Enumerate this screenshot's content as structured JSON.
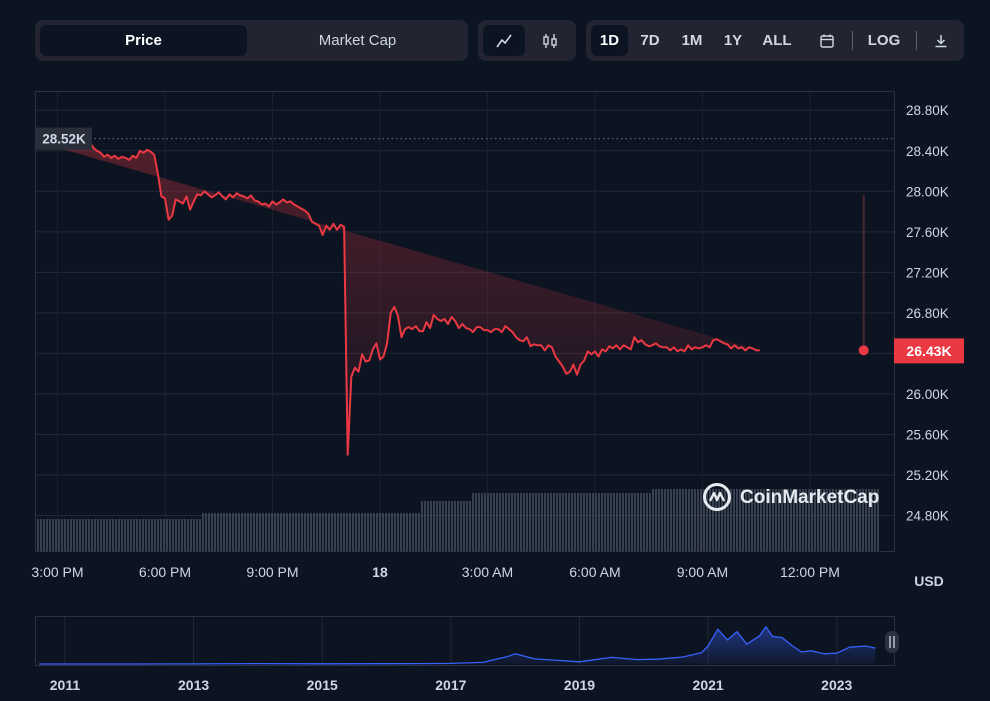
{
  "toolbar": {
    "type_options": [
      {
        "label": "Price",
        "active": true
      },
      {
        "label": "Market Cap",
        "active": false
      }
    ],
    "view_options": [
      {
        "icon": "line-chart-icon",
        "active": true
      },
      {
        "icon": "candlestick-icon",
        "active": false
      }
    ],
    "range_options": [
      {
        "label": "1D",
        "active": true
      },
      {
        "label": "7D",
        "active": false
      },
      {
        "label": "1M",
        "active": false
      },
      {
        "label": "1Y",
        "active": false
      },
      {
        "label": "ALL",
        "active": false
      }
    ],
    "calendar_icon": "calendar-icon",
    "log_label": "LOG",
    "download_icon": "download-icon"
  },
  "watermark": "CoinMarketCap",
  "currency_label": "USD",
  "chart_data": [
    {
      "type": "area",
      "y_ticks": [
        24800,
        25200,
        25600,
        26000,
        26400,
        26800,
        27200,
        27600,
        28000,
        28400,
        28800
      ],
      "y_tick_labels": [
        "24.80K",
        "25.20K",
        "25.60K",
        "26.00K",
        "26.40K",
        "26.80K",
        "27.20K",
        "27.60K",
        "28.00K",
        "28.40K",
        "28.80K"
      ],
      "ylim": [
        24450,
        28980
      ],
      "x_ticks": [
        {
          "label": "3:00 PM",
          "x": 1.5
        },
        {
          "label": "6:00 PM",
          "x": 4.5
        },
        {
          "label": "9:00 PM",
          "x": 7.5
        },
        {
          "label": "18",
          "x": 10.5
        },
        {
          "label": "3:00 AM",
          "x": 13.5
        },
        {
          "label": "6:00 AM",
          "x": 16.5
        },
        {
          "label": "9:00 AM",
          "x": 19.5
        },
        {
          "label": "12:00 PM",
          "x": 22.5
        }
      ],
      "xlim": [
        0.9,
        24.4
      ],
      "high_label": "28.52K",
      "high_value": 28520,
      "last_label": "26.43K",
      "last_value": 26430,
      "line_color": "#ea3943",
      "x": [
        1.6,
        1.7,
        1.8,
        1.9,
        2.0,
        2.1,
        2.2,
        2.3,
        2.4,
        2.5,
        2.6,
        2.7,
        2.8,
        2.9,
        3.0,
        3.1,
        3.2,
        3.3,
        3.4,
        3.5,
        3.6,
        3.7,
        3.8,
        3.9,
        4.0,
        4.1,
        4.2,
        4.3,
        4.4,
        4.5,
        4.6,
        4.7,
        4.8,
        4.9,
        5.0,
        5.1,
        5.2,
        5.3,
        5.4,
        5.5,
        5.6,
        5.7,
        5.8,
        5.9,
        6.0,
        6.1,
        6.2,
        6.3,
        6.4,
        6.5,
        6.6,
        6.7,
        6.8,
        6.9,
        7.0,
        7.1,
        7.2,
        7.3,
        7.4,
        7.5,
        7.6,
        7.7,
        7.8,
        7.9,
        8.0,
        8.1,
        8.2,
        8.3,
        8.4,
        8.5,
        8.6,
        8.7,
        8.8,
        8.9,
        9.0,
        9.1,
        9.2,
        9.3,
        9.4,
        9.5,
        9.6,
        9.7,
        9.8,
        9.9,
        10.0,
        10.1,
        10.2,
        10.3,
        10.4,
        10.5,
        10.6,
        10.7,
        10.8,
        10.9,
        11.0,
        11.1,
        11.2,
        11.3,
        11.4,
        11.5,
        11.6,
        11.7,
        11.8,
        11.9,
        12.0,
        12.1,
        12.2,
        12.3,
        12.4,
        12.5,
        12.6,
        12.7,
        12.8,
        12.9,
        13.0,
        13.1,
        13.2,
        13.3,
        13.4,
        13.5,
        13.6,
        13.7,
        13.8,
        13.9,
        14.0,
        14.1,
        14.2,
        14.3,
        14.4,
        14.5,
        14.6,
        14.7,
        14.8,
        14.9,
        15.0,
        15.1,
        15.2,
        15.3,
        15.4,
        15.5,
        15.6,
        15.7,
        15.8,
        15.9,
        16.0,
        16.1,
        16.2,
        16.3,
        16.4,
        16.5,
        16.6,
        16.7,
        16.8,
        16.9,
        17.0,
        17.1,
        17.2,
        17.3,
        17.4,
        17.5,
        17.6,
        17.7,
        17.8,
        17.9,
        18.0,
        18.1,
        18.2,
        18.3,
        18.4,
        18.5,
        18.6,
        18.7,
        18.8,
        18.9,
        19.0,
        19.1,
        19.2,
        19.3,
        19.4,
        19.5,
        19.6,
        19.7,
        19.8,
        19.9,
        20.0,
        20.1,
        20.2,
        20.3,
        20.4,
        20.5,
        20.6,
        20.7,
        20.8,
        20.9,
        21.0,
        21.1,
        21.2,
        21.3,
        21.4,
        21.5,
        21.6,
        21.7,
        21.8,
        21.9,
        22.0,
        22.1,
        22.2,
        22.3,
        22.4,
        22.5,
        22.6,
        22.7,
        22.8,
        22.9,
        23.0,
        23.1,
        23.2,
        23.3,
        23.4,
        23.5,
        23.6,
        23.7,
        23.8,
        23.9,
        24.0
      ],
      "y": [
        28420,
        28500,
        28480,
        28510,
        28460,
        28480,
        28430,
        28450,
        28490,
        28430,
        28400,
        28380,
        28340,
        28360,
        28330,
        28350,
        28320,
        28340,
        28330,
        28310,
        28350,
        28330,
        28400,
        28380,
        28410,
        28390,
        28360,
        28180,
        27950,
        27930,
        27720,
        27760,
        27920,
        27900,
        27880,
        27950,
        27820,
        27900,
        27970,
        27960,
        28000,
        27970,
        27940,
        27960,
        27990,
        27950,
        27920,
        27970,
        27940,
        27980,
        27960,
        27950,
        27930,
        27960,
        27910,
        27900,
        27870,
        27880,
        27850,
        27900,
        27870,
        27890,
        27920,
        27890,
        27900,
        27870,
        27850,
        27830,
        27810,
        27780,
        27700,
        27680,
        27660,
        27570,
        27660,
        27620,
        27680,
        27620,
        27670,
        27650,
        25400,
        26170,
        26260,
        26220,
        26390,
        26320,
        26330,
        26440,
        26500,
        26340,
        26370,
        26500,
        26800,
        26860,
        26770,
        26560,
        26640,
        26660,
        26640,
        26670,
        26620,
        26620,
        26710,
        26650,
        26780,
        26740,
        26720,
        26740,
        26690,
        26760,
        26720,
        26650,
        26690,
        26650,
        26640,
        26610,
        26660,
        26660,
        26630,
        26630,
        26610,
        26640,
        26640,
        26610,
        26670,
        26640,
        26610,
        26560,
        26530,
        26520,
        26560,
        26470,
        26490,
        26480,
        26480,
        26430,
        26480,
        26460,
        26370,
        26320,
        26270,
        26200,
        26220,
        26290,
        26190,
        26290,
        26330,
        26420,
        26390,
        26420,
        26370,
        26440,
        26420,
        26470,
        26450,
        26480,
        26440,
        26480,
        26460,
        26440,
        26560,
        26510,
        26530,
        26490,
        26470,
        26480,
        26500,
        26470,
        26460,
        26460,
        26430,
        26460,
        26420,
        26440,
        26420,
        26480,
        26440,
        26460,
        26450,
        26460,
        26480,
        26460,
        26530,
        26540,
        26520,
        26500,
        26490,
        26450,
        26480,
        26450,
        26460,
        26430,
        26460,
        26450,
        26430,
        26430
      ],
      "volume_max": 1.0
    },
    {
      "type": "area",
      "x_tick_labels": [
        "2011",
        "2013",
        "2015",
        "2017",
        "2019",
        "2021",
        "2023"
      ],
      "x_ticks": [
        2011,
        2013,
        2015,
        2017,
        2019,
        2021,
        2023
      ],
      "xlim": [
        2010.55,
        2023.75
      ],
      "ylim": [
        0,
        70000
      ],
      "line_color": "#3861fb",
      "x": [
        2010.6,
        2011,
        2012,
        2013,
        2014,
        2015,
        2016,
        2016.5,
        2017,
        2017.5,
        2017.9,
        2018,
        2018.3,
        2018.6,
        2019,
        2019.5,
        2019.9,
        2020.2,
        2020.6,
        2020.9,
        2021.0,
        2021.15,
        2021.3,
        2021.45,
        2021.6,
        2021.8,
        2021.9,
        2022.0,
        2022.15,
        2022.3,
        2022.45,
        2022.6,
        2022.8,
        2023.0,
        2023.2,
        2023.45,
        2023.6
      ],
      "y": [
        0,
        1,
        6,
        100,
        600,
        300,
        420,
        650,
        1000,
        2600,
        13000,
        17000,
        8500,
        6500,
        3700,
        11000,
        7300,
        8000,
        11500,
        19000,
        30000,
        58000,
        40000,
        54000,
        33000,
        47000,
        62000,
        46000,
        44000,
        31000,
        20000,
        22000,
        17000,
        18000,
        28000,
        30000,
        26500
      ]
    }
  ]
}
